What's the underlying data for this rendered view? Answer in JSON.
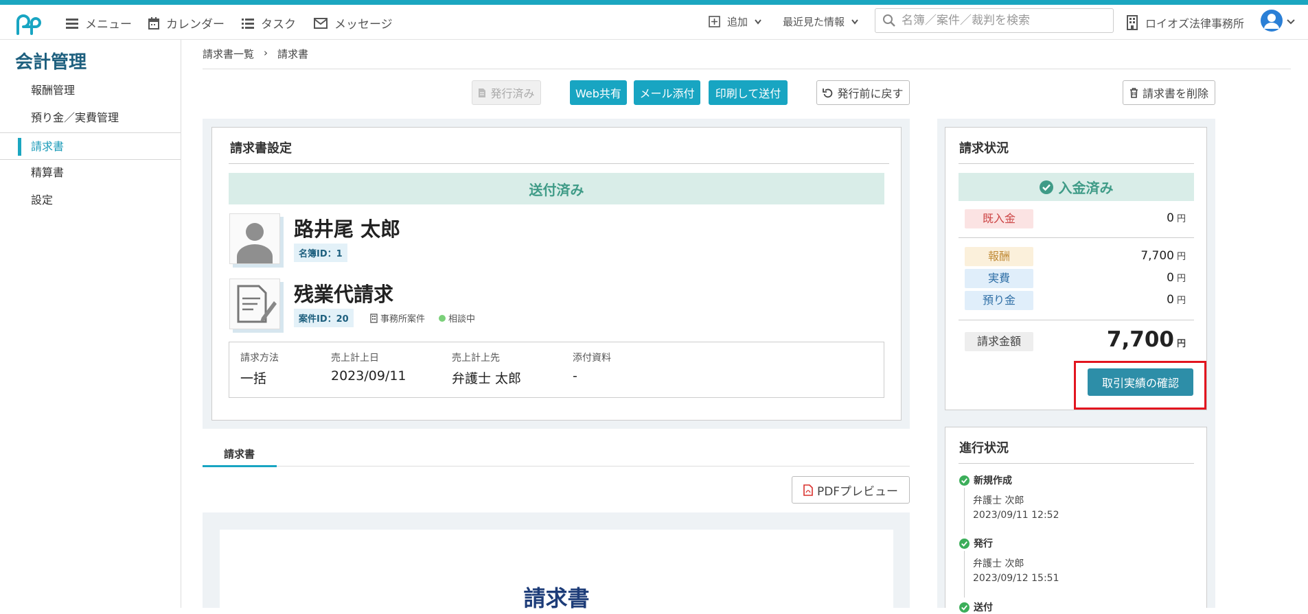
{
  "header": {
    "menu_label": "メニュー",
    "calendar_label": "カレンダー",
    "task_label": "タスク",
    "message_label": "メッセージ",
    "add_label": "追加",
    "recent_label": "最近見た情報",
    "search_placeholder": "名簿／案件／裁判を検索",
    "office_name": "ロイオズ法律事務所"
  },
  "sidebar": {
    "title": "会計管理",
    "items": [
      {
        "label": "報酬管理"
      },
      {
        "label": "預り金／実費管理"
      },
      {
        "label": "請求書"
      },
      {
        "label": "精算書"
      },
      {
        "label": "設定"
      }
    ],
    "active_index": 2
  },
  "breadcrumb": {
    "parent": "請求書一覧",
    "separator": "›",
    "current": "請求書"
  },
  "actions": {
    "issued_label": "発行済み",
    "web_share_label": "Web共有",
    "mail_attach_label": "メール添付",
    "print_send_label": "印刷して送付",
    "revert_label": "発行前に戻す",
    "delete_label": "請求書を削除"
  },
  "settings_card": {
    "title": "請求書設定",
    "status_banner": "送付済み",
    "person_name": "路井尾 太郎",
    "person_id_tag": "名簿ID：1",
    "case_name": "残業代請求",
    "case_id_tag": "案件ID：20",
    "case_type": "事務所案件",
    "case_status": "相談中",
    "fields": [
      {
        "label": "請求方法",
        "value": "一括"
      },
      {
        "label": "売上計上日",
        "value": "2023/09/11"
      },
      {
        "label": "売上計上先",
        "value": "弁護士 太郎"
      },
      {
        "label": "添付資料",
        "value": "-"
      }
    ]
  },
  "status_card": {
    "title": "請求状況",
    "banner": "入金済み",
    "received": {
      "label": "既入金",
      "amount": "0",
      "unit": "円"
    },
    "breakdown": [
      {
        "label": "報酬",
        "amount": "7,700",
        "unit": "円"
      },
      {
        "label": "実費",
        "amount": "0",
        "unit": "円"
      },
      {
        "label": "預り金",
        "amount": "0",
        "unit": "円"
      }
    ],
    "total": {
      "label": "請求金額",
      "amount": "7,700",
      "unit": "円"
    },
    "transaction_button": "取引実績の確認"
  },
  "progress_card": {
    "title": "進行状況",
    "steps": [
      {
        "title": "新規作成",
        "user": "弁護士 次郎",
        "time": "2023/09/11 12:52"
      },
      {
        "title": "発行",
        "user": "弁護士 次郎",
        "time": "2023/09/12 15:51"
      },
      {
        "title": "送付",
        "user": "",
        "time": ""
      }
    ]
  },
  "tabs": {
    "invoice_tab": "請求書"
  },
  "preview": {
    "pdf_button": "PDFプレビュー",
    "doc_title": "請求書"
  },
  "colors": {
    "accent": "#18a5c2",
    "brand_dark": "#1d5f7e",
    "success": "#3cae5a",
    "highlight": "#e2151f"
  }
}
